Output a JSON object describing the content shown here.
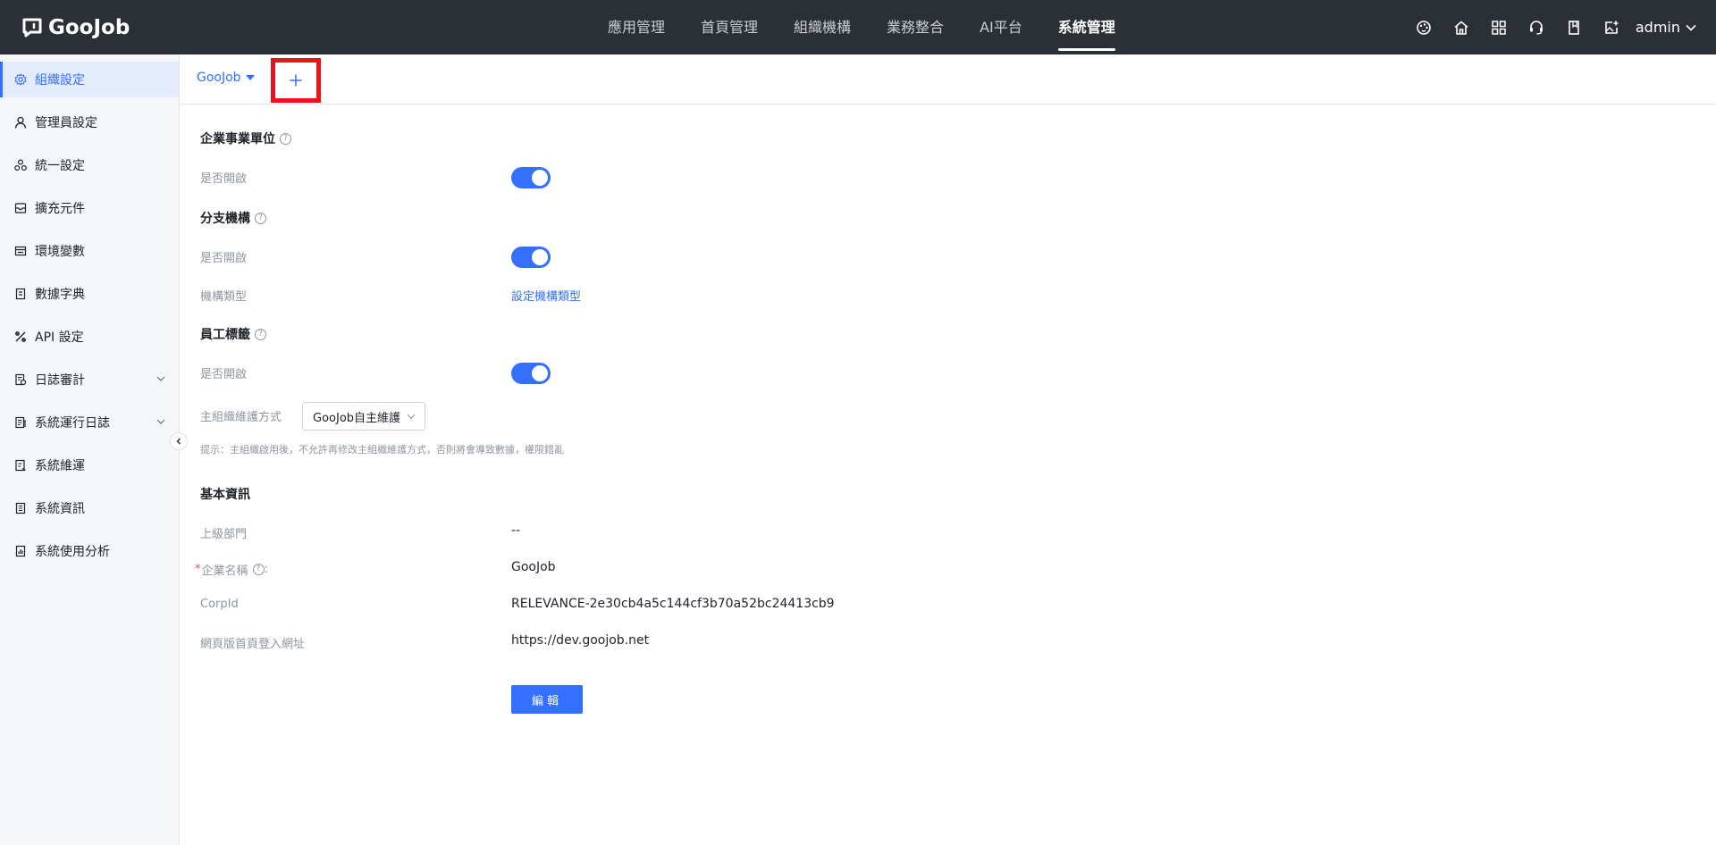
{
  "brand": {
    "logo_text": "GooJob"
  },
  "nav": {
    "items": [
      {
        "label": "應用管理"
      },
      {
        "label": "首頁管理"
      },
      {
        "label": "組織機構"
      },
      {
        "label": "業務整合"
      },
      {
        "label": "AI平台"
      },
      {
        "label": "系統管理",
        "active": true
      }
    ]
  },
  "header": {
    "user": "admin"
  },
  "sidebar": {
    "items": [
      {
        "label": "組織設定",
        "icon": "gear-icon",
        "active": true
      },
      {
        "label": "管理員設定",
        "icon": "user-icon"
      },
      {
        "label": "統一設定",
        "icon": "cluster-icon"
      },
      {
        "label": "擴充元件",
        "icon": "box-icon"
      },
      {
        "label": "環境變數",
        "icon": "window-icon"
      },
      {
        "label": "數據字典",
        "icon": "book-icon"
      },
      {
        "label": "API 設定",
        "icon": "api-icon"
      },
      {
        "label": "日誌審計",
        "icon": "audit-icon",
        "expandable": true
      },
      {
        "label": "系統運行日誌",
        "icon": "log-icon",
        "expandable": true
      },
      {
        "label": "系統維運",
        "icon": "ops-icon"
      },
      {
        "label": "系統資訊",
        "icon": "info-doc-icon"
      },
      {
        "label": "系統使用分析",
        "icon": "analysis-icon"
      }
    ]
  },
  "tabs": {
    "org_tab": "GooJob",
    "add_symbol": "+"
  },
  "sections": {
    "enterprise_unit": {
      "title": "企業事業單位",
      "enabled_label": "是否開啟",
      "enabled": true
    },
    "branch": {
      "title": "分支機構",
      "enabled_label": "是否開啟",
      "enabled": true,
      "type_label": "機構類型",
      "type_link": "設定機構類型"
    },
    "employee_tag": {
      "title": "員工標籤",
      "enabled_label": "是否開啟",
      "enabled": true,
      "maintenance_label": "主組織維護方式",
      "maintenance_value": "GooJob自主維護",
      "hint": "提示：主組織啟用後，不允許再修改主組織維護方式，否則將會導致數據，權限錯亂"
    },
    "basic_info": {
      "title": "基本資訊",
      "parent_label": "上級部門",
      "parent_value": "--",
      "name_label": "企業名稱",
      "name_required": "*",
      "name_suffix": ":",
      "name_value": "GooJob",
      "corpid_label": "CorpId",
      "corpid_value": "RELEVANCE-2e30cb4a5c144cf3b70a52bc24413cb9",
      "url_label": "網頁版首頁登入網址",
      "url_value": "https://dev.goojob.net",
      "edit_button": "編輯"
    }
  },
  "colors": {
    "topbar": "#2b2f36",
    "accent": "#3370ff",
    "highlight_box": "#e8141b"
  }
}
